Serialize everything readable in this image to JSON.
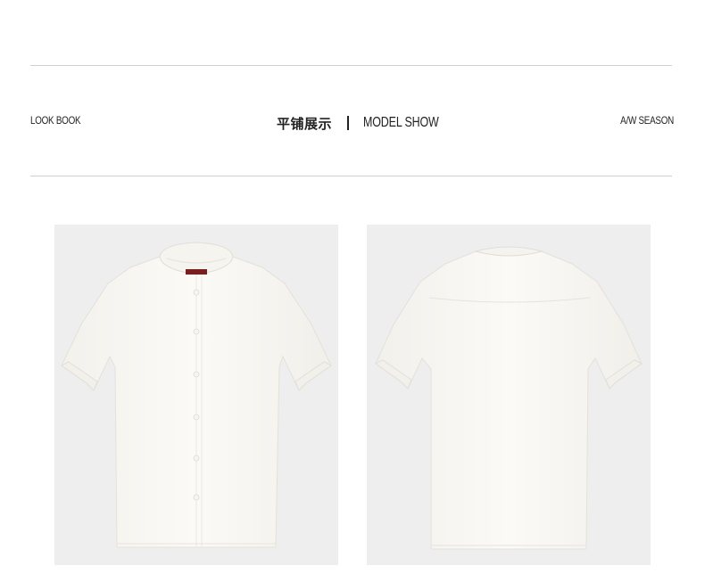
{
  "header": {
    "left_label": "LOOK BOOK",
    "center_cn": "平铺展示",
    "center_en": "MODEL SHOW",
    "right_label": "A/W SEASON"
  },
  "photos": [
    {
      "view": "front",
      "product": "white short-sleeve stand-collar shirt"
    },
    {
      "view": "back",
      "product": "white short-sleeve stand-collar shirt"
    }
  ],
  "colors": {
    "background": "#ffffff",
    "divider": "#cfcfcf",
    "photo_bg": "#eeeeef",
    "shirt": "#faf8f3",
    "text": "#222222"
  }
}
